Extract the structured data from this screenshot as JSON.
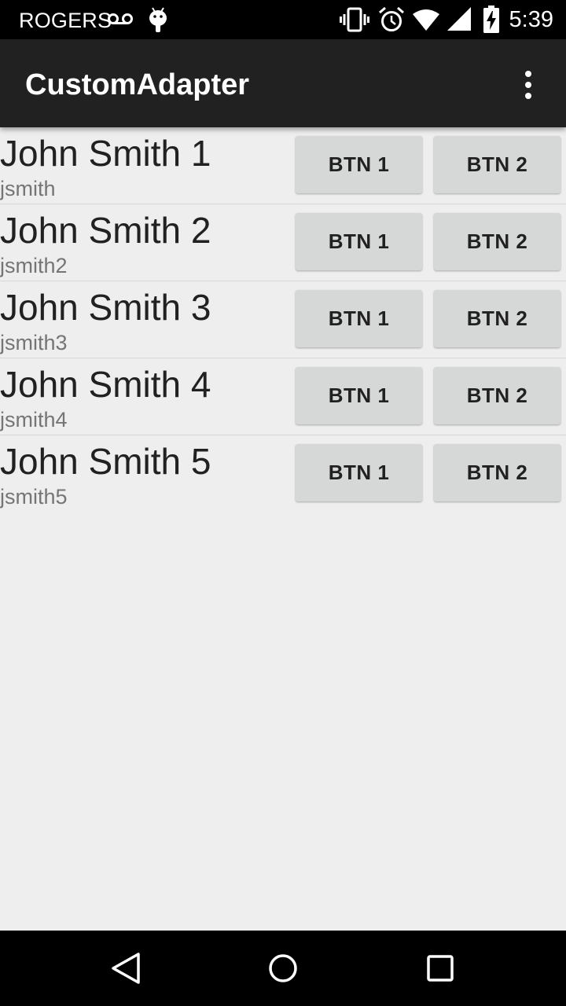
{
  "status_bar": {
    "carrier": "ROGERS",
    "time": "5:39",
    "icons": [
      "voicemail-icon",
      "android-icon",
      "vibrate-icon",
      "alarm-icon",
      "wifi-icon",
      "signal-icon",
      "battery-charging-icon"
    ]
  },
  "app_bar": {
    "title": "CustomAdapter",
    "overflow_icon": "more-vert-icon"
  },
  "list": {
    "items": [
      {
        "name": "John Smith 1",
        "username": "jsmith",
        "btn1": "BTN 1",
        "btn2": "BTN 2"
      },
      {
        "name": "John Smith 2",
        "username": "jsmith2",
        "btn1": "BTN 1",
        "btn2": "BTN 2"
      },
      {
        "name": "John Smith 3",
        "username": "jsmith3",
        "btn1": "BTN 1",
        "btn2": "BTN 2"
      },
      {
        "name": "John Smith 4",
        "username": "jsmith4",
        "btn1": "BTN 1",
        "btn2": "BTN 2"
      },
      {
        "name": "John Smith 5",
        "username": "jsmith5",
        "btn1": "BTN 1",
        "btn2": "BTN 2"
      }
    ]
  },
  "nav_bar": {
    "icons": [
      "back-icon",
      "home-icon",
      "recents-icon"
    ]
  },
  "colors": {
    "app_bar": "#212121",
    "background": "#eeeeee",
    "button": "#d6d7d7",
    "status_bar": "#000000"
  }
}
